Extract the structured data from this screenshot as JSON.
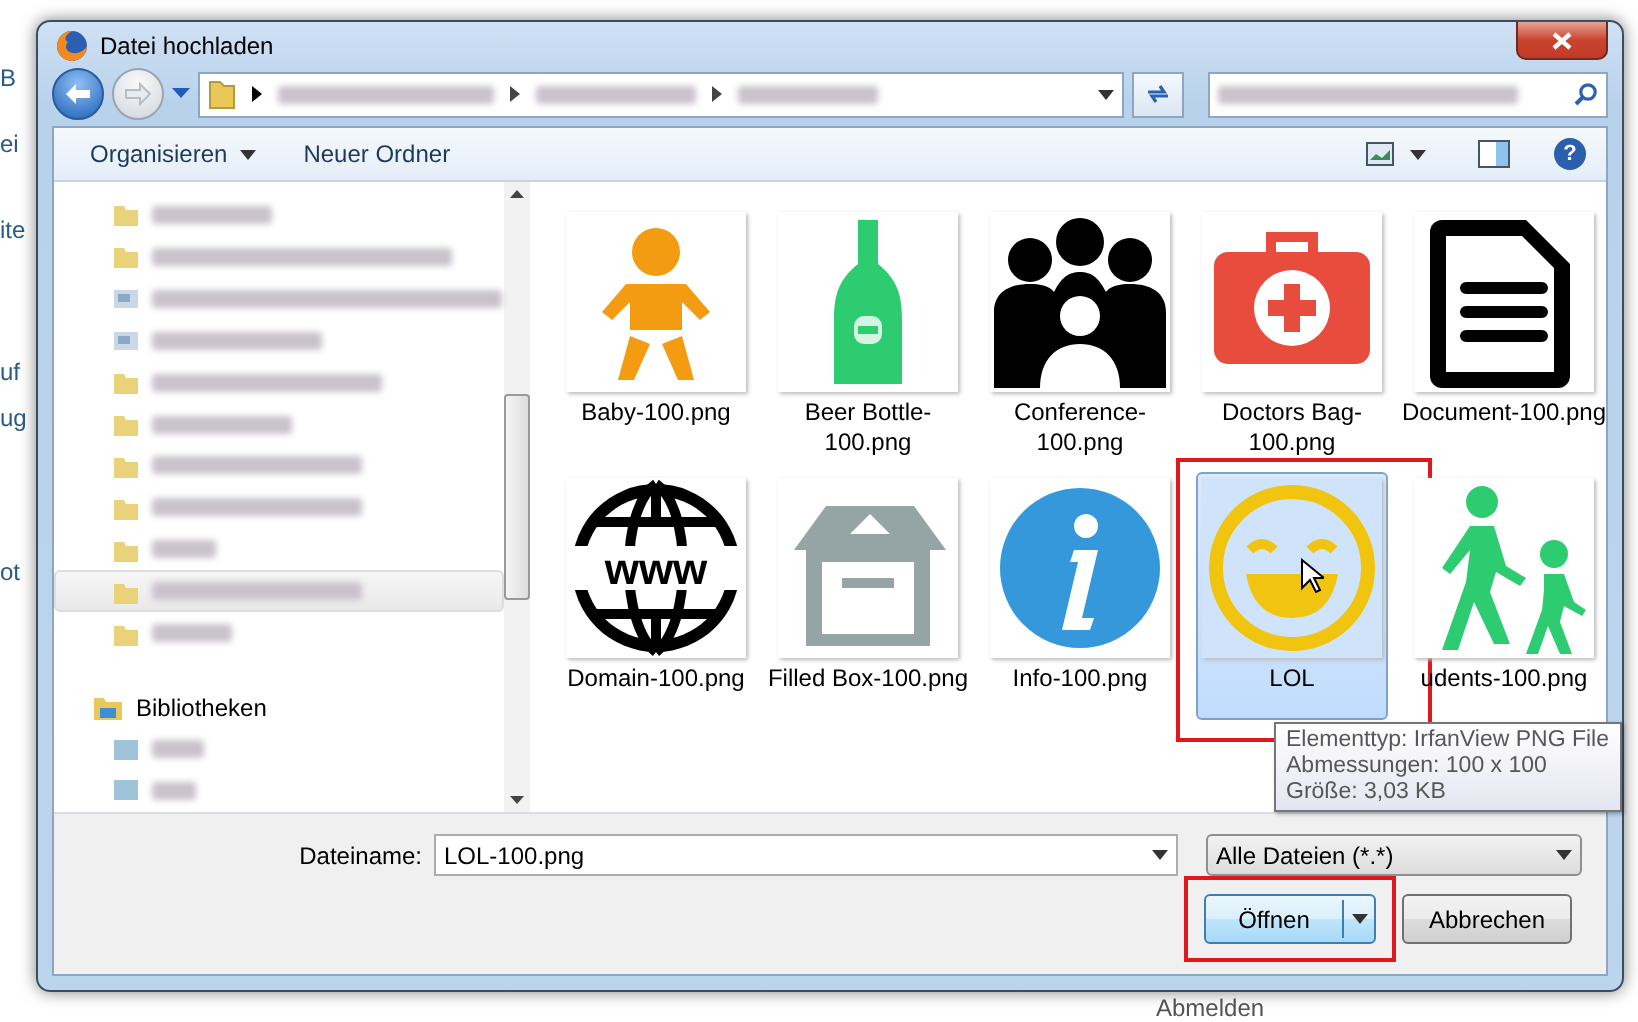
{
  "window": {
    "title": "Datei hochladen"
  },
  "background_page": {
    "left_fragments": [
      "B",
      "ei",
      "ite",
      "uf",
      "ug",
      "ot"
    ],
    "bottom_label": "Abmelden"
  },
  "toolbar": {
    "buttons": [
      {
        "label": "Organisieren",
        "kind": "menu"
      },
      {
        "label": "Neuer Ordner",
        "kind": "plain"
      }
    ],
    "help_glyph": "?"
  },
  "navigation": {
    "items": [
      {
        "kind": "folder",
        "selected": false
      },
      {
        "kind": "folder",
        "selected": false
      },
      {
        "kind": "drive",
        "selected": false
      },
      {
        "kind": "drive",
        "selected": false
      },
      {
        "kind": "folder",
        "selected": false
      },
      {
        "kind": "folder",
        "selected": false
      },
      {
        "kind": "folder",
        "selected": false
      },
      {
        "kind": "folder",
        "selected": false
      },
      {
        "kind": "folder",
        "selected": false
      },
      {
        "kind": "folder",
        "selected": true
      },
      {
        "kind": "folder",
        "selected": false
      }
    ],
    "library": {
      "label": "Bibliotheken",
      "children": [
        {
          "kind": "library-item"
        },
        {
          "kind": "library-item"
        }
      ]
    }
  },
  "files": [
    {
      "name": "Baby-100.png",
      "kind": "baby",
      "selected": false,
      "highlighted": false
    },
    {
      "name": "Beer Bottle-100.png",
      "kind": "bottle",
      "selected": false,
      "highlighted": false
    },
    {
      "name": "Conference-100.png",
      "kind": "people",
      "selected": false,
      "highlighted": false
    },
    {
      "name": "Doctors Bag-100.png",
      "kind": "medkit",
      "selected": false,
      "highlighted": false
    },
    {
      "name": "Document-100.png",
      "kind": "document",
      "selected": false,
      "highlighted": false
    },
    {
      "name": "Domain-100.png",
      "kind": "globe",
      "icon_text": "www",
      "selected": false,
      "highlighted": false
    },
    {
      "name": "Filled Box-100.png",
      "kind": "box",
      "selected": false,
      "highlighted": false
    },
    {
      "name": "Info-100.png",
      "kind": "info",
      "selected": false,
      "highlighted": false
    },
    {
      "name": "LOL",
      "kind": "smiley",
      "selected": true,
      "highlighted": true
    },
    {
      "name": "udents-100.png",
      "kind": "walkers",
      "selected": false,
      "highlighted": false
    }
  ],
  "tooltip": {
    "lines": [
      "Elementtyp: IrfanView PNG File",
      "Abmessungen: 100 x 100",
      "Größe: 3,03 KB"
    ]
  },
  "filename": {
    "label": "Dateiname:",
    "value": "LOL-100.png"
  },
  "filter": {
    "value": "Alle Dateien (*.*)"
  },
  "buttons": [
    {
      "label": "Öffnen",
      "kind": "split",
      "highlighted": true
    },
    {
      "label": "Abbrechen",
      "kind": "plain",
      "highlighted": false
    }
  ]
}
